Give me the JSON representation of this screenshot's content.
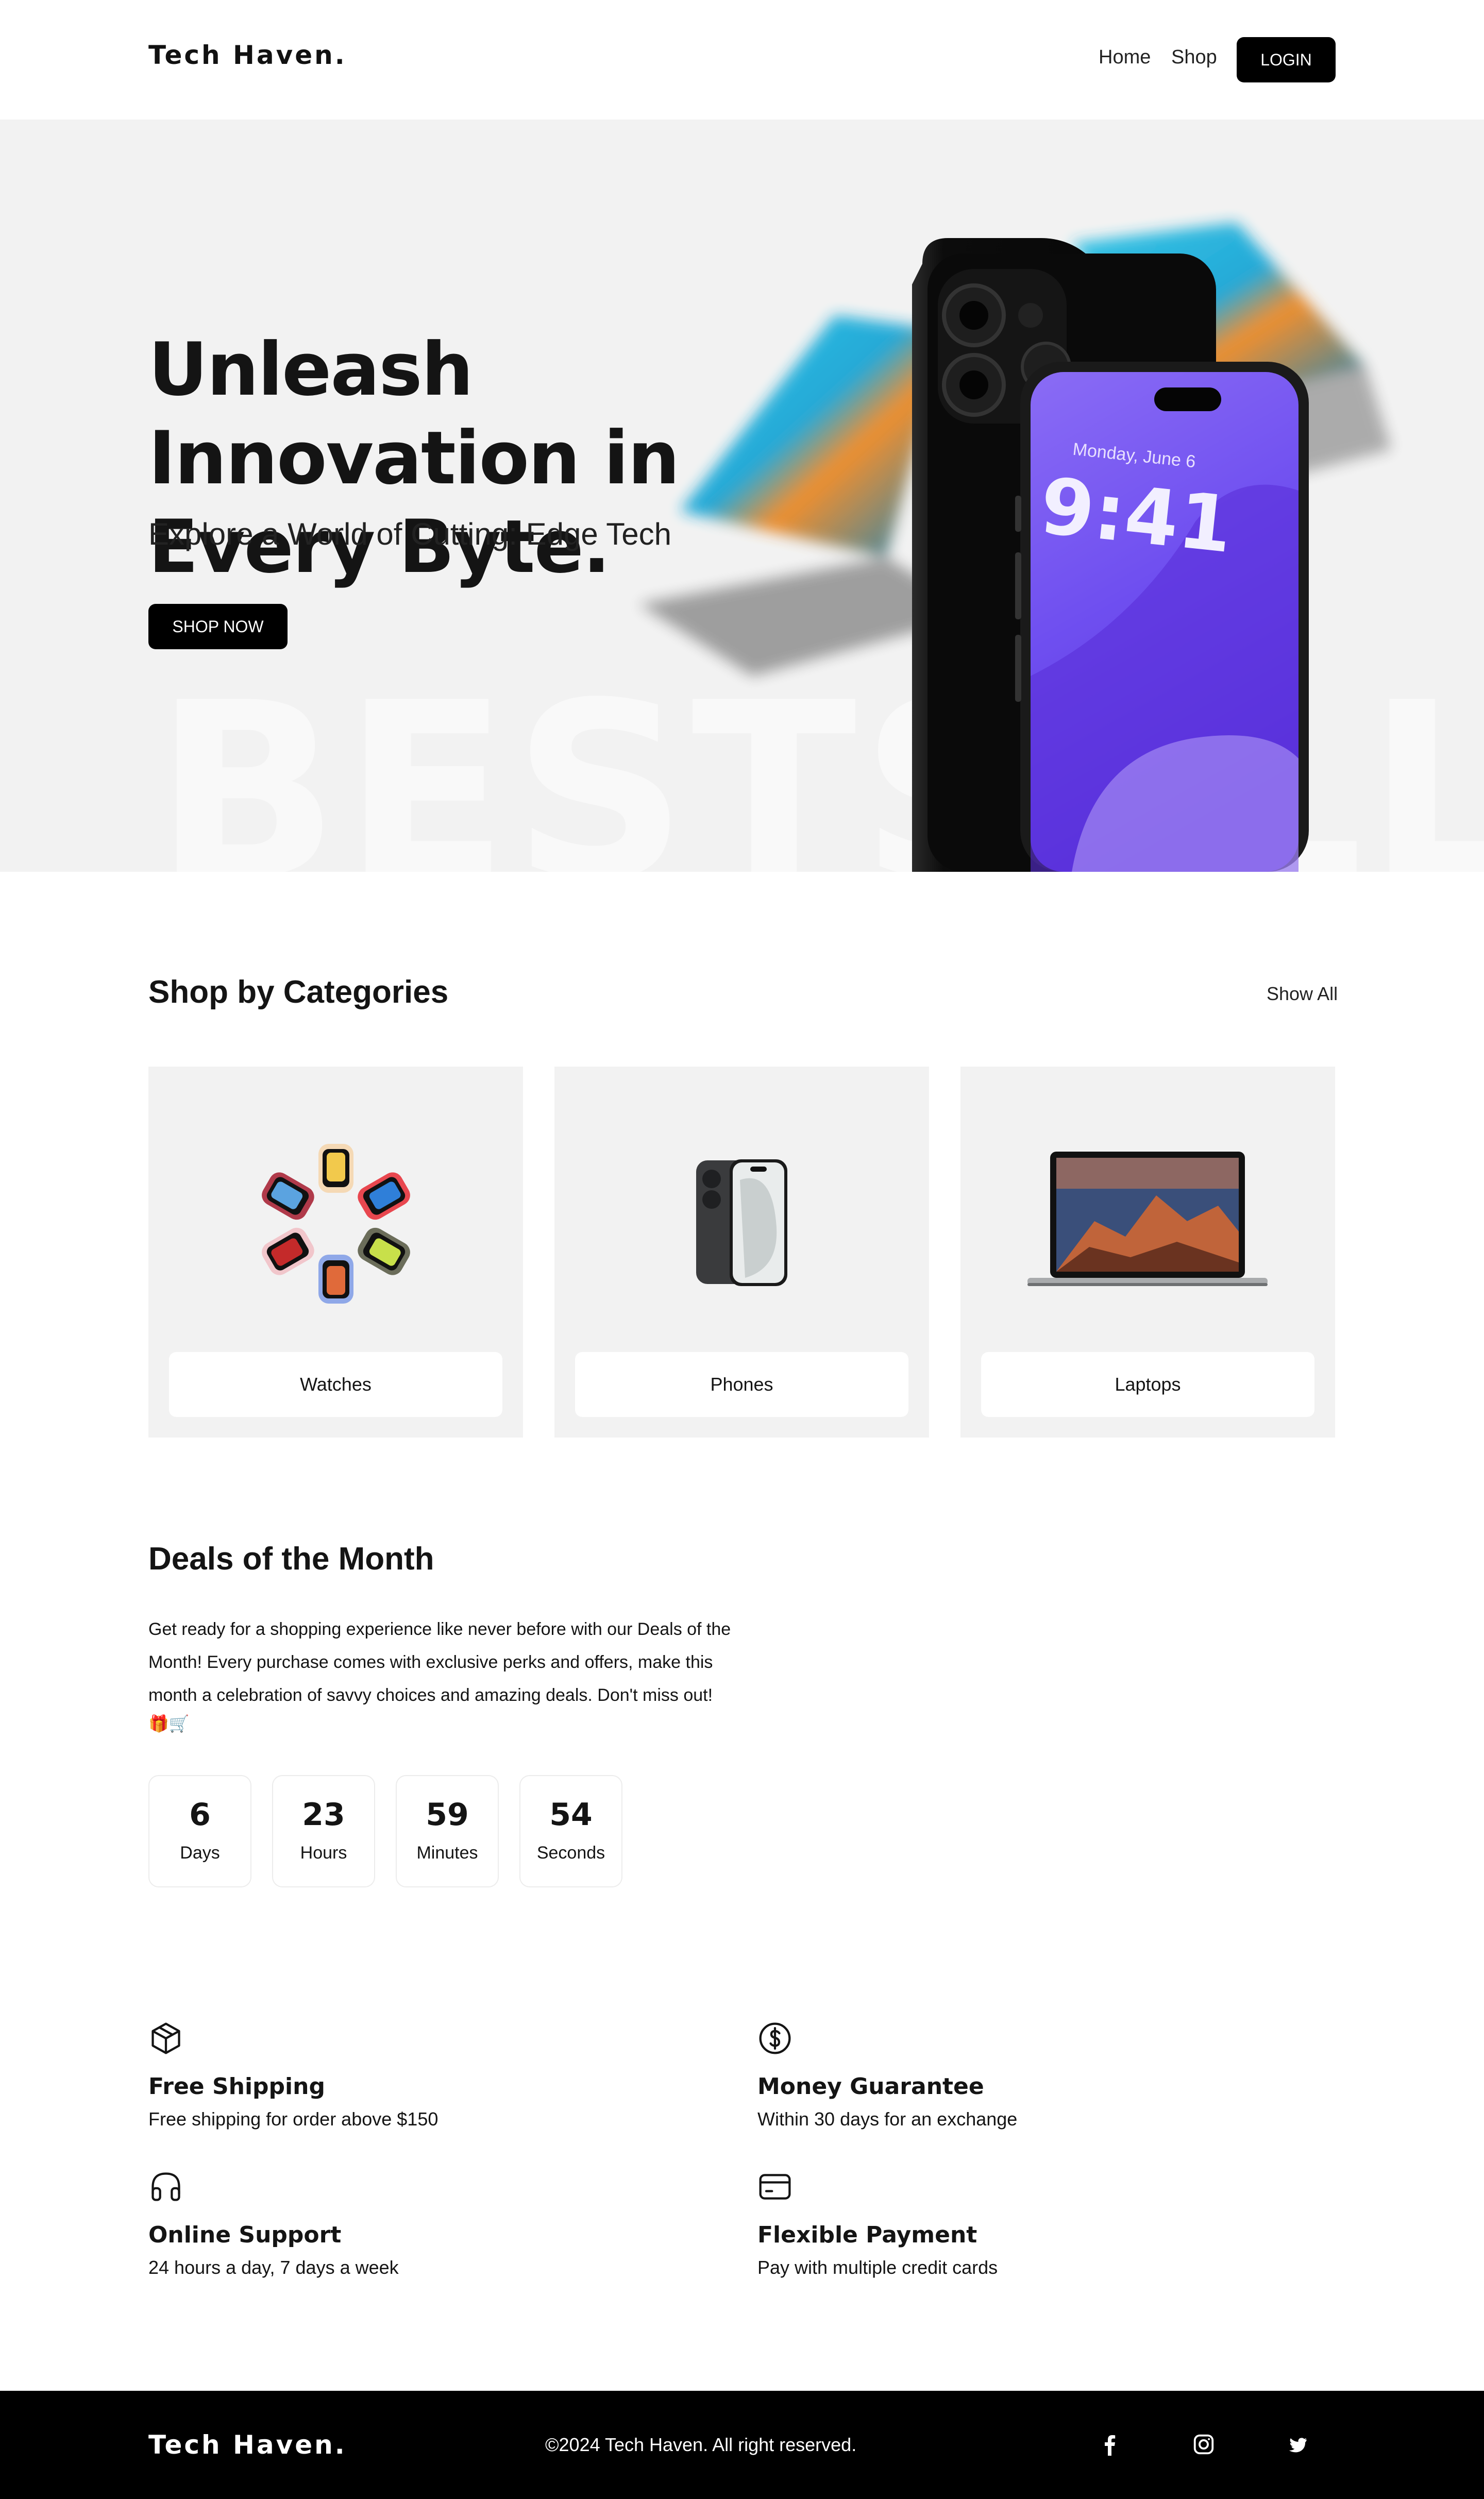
{
  "header": {
    "logo": "Tech Haven.",
    "nav": {
      "home": "Home",
      "shop": "Shop"
    },
    "login_label": "LOGIN"
  },
  "hero": {
    "title": "Unleash Innovation in Every Byte.",
    "subtitle": "Explore a World of Cutting: Edge Tech",
    "cta_label": "SHOP NOW",
    "watermark": "BESTSELLER",
    "phone_date": "Monday, June 6",
    "phone_time": "9:41"
  },
  "categories": {
    "title": "Shop by Categories",
    "show_all": "Show All",
    "items": [
      {
        "label": "Watches"
      },
      {
        "label": "Phones"
      },
      {
        "label": "Laptops"
      }
    ]
  },
  "deals": {
    "title": "Deals of the Month",
    "text": "Get ready for a shopping experience like never before with our Deals of the Month! Every purchase comes with exclusive perks and offers, make this month a celebration of savvy choices and amazing deals. Don't miss out!",
    "emoji": "🎁🛒",
    "countdown": [
      {
        "value": "6",
        "unit": "Days"
      },
      {
        "value": "23",
        "unit": "Hours"
      },
      {
        "value": "59",
        "unit": "Minutes"
      },
      {
        "value": "54",
        "unit": "Seconds"
      }
    ]
  },
  "features": [
    {
      "icon": "package-icon",
      "title": "Free Shipping",
      "desc": "Free shipping for order above $150"
    },
    {
      "icon": "dollar-circle-icon",
      "title": "Money Guarantee",
      "desc": "Within 30 days for an exchange"
    },
    {
      "icon": "headphones-icon",
      "title": "Online Support",
      "desc": "24 hours a day, 7 days a week"
    },
    {
      "icon": "credit-card-icon",
      "title": "Flexible Payment",
      "desc": "Pay with multiple credit cards"
    }
  ],
  "footer": {
    "logo": "Tech Haven.",
    "copyright": "©2024 Tech Haven. All right reserved.",
    "social": [
      "facebook-icon",
      "instagram-icon",
      "twitter-icon"
    ]
  },
  "colors": {
    "primary": "#000000",
    "hero_bg": "#f2f2f2",
    "card_bg": "#f2f2f2",
    "phone_screen": "#7b5cf0"
  }
}
